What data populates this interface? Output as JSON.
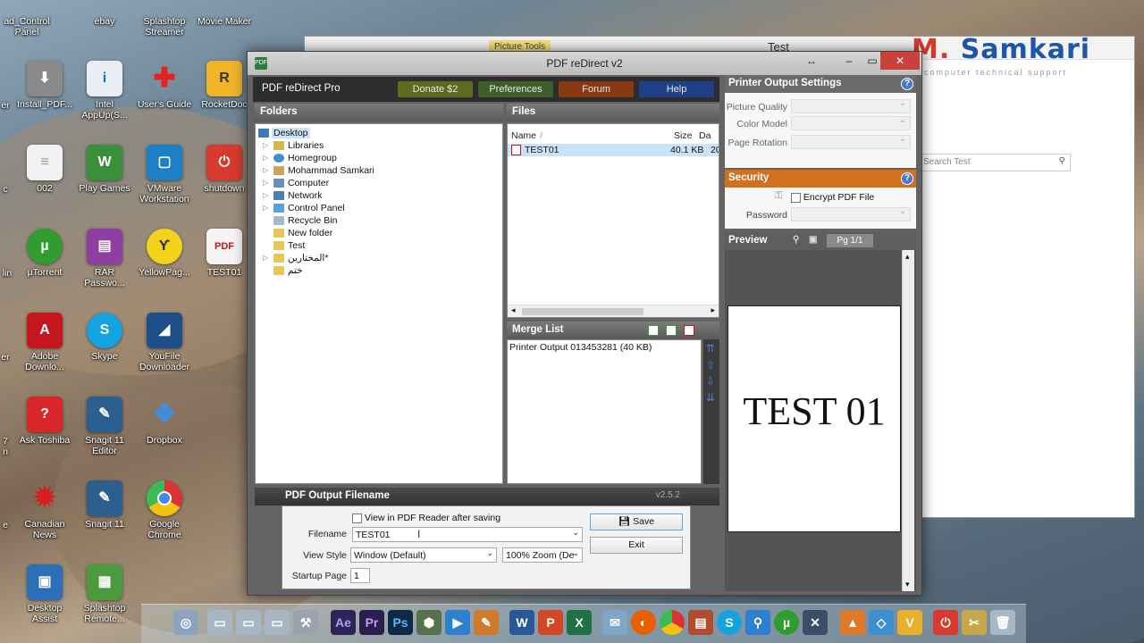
{
  "desktop": {
    "col_partial": [
      {
        "label": "ad_Control Panel"
      },
      {
        "label": "er"
      },
      {
        "label": "c"
      },
      {
        "label": "lin"
      },
      {
        "label": "er"
      },
      {
        "label": "7\nn"
      },
      {
        "label": "e"
      }
    ],
    "icons_col1": [
      {
        "label": "Install_PDF..."
      },
      {
        "label": "002"
      },
      {
        "label": "µTorrent"
      },
      {
        "label": "Adobe\nDownlo..."
      },
      {
        "label": "Ask Toshiba"
      },
      {
        "label": "Canadian\nNews"
      },
      {
        "label": "Desktop\nAssist"
      }
    ],
    "icons_col2": [
      {
        "label": "ebay"
      },
      {
        "label": "Intel\nAppUp(S..."
      },
      {
        "label": "Play Games"
      },
      {
        "label": "RAR\nPasswo..."
      },
      {
        "label": "Skype"
      },
      {
        "label": "Snagit 11\nEditor"
      },
      {
        "label": "Snagit 11"
      },
      {
        "label": "Splashtop\nRemote..."
      }
    ],
    "icons_col3": [
      {
        "label": "Splashtop\nStreamer"
      },
      {
        "label": "User's Guide"
      },
      {
        "label": "VMware\nWorkstation"
      },
      {
        "label": "YellowPag..."
      },
      {
        "label": "YouFile\nDownloader"
      },
      {
        "label": "Dropbox"
      },
      {
        "label": "Google\nChrome"
      }
    ],
    "icons_col4": [
      {
        "label": "Movie Maker"
      },
      {
        "label": "RocketDoc"
      },
      {
        "label": "shutdown"
      },
      {
        "label": "TEST01"
      }
    ]
  },
  "background_window": {
    "picture_tools": "Picture Tools",
    "title": "Test",
    "search_placeholder": "Search Test"
  },
  "logo": {
    "text_m": "M.",
    "text_name": "Samkari",
    "sub": "computer technical support"
  },
  "app": {
    "title": "PDF reDirect v2",
    "product": "PDF reDirect Pro",
    "buttons": {
      "donate": "Donate $2",
      "preferences": "Preferences",
      "forum": "Forum",
      "help": "Help"
    },
    "folders": {
      "header": "Folders",
      "items": [
        {
          "label": "Desktop"
        },
        {
          "label": "Libraries"
        },
        {
          "label": "Homegroup"
        },
        {
          "label": "Mohammad Samkari"
        },
        {
          "label": "Computer"
        },
        {
          "label": "Network"
        },
        {
          "label": "Control Panel"
        },
        {
          "label": "Recycle Bin"
        },
        {
          "label": "New folder"
        },
        {
          "label": "Test"
        },
        {
          "label": "المختارين*"
        },
        {
          "label": "ختم"
        }
      ]
    },
    "files": {
      "header": "Files",
      "col_name": "Name",
      "col_sort": "/",
      "col_size": "Size",
      "col_date": "Da",
      "rows": [
        {
          "name": "TEST01",
          "size": "40.1 KB",
          "date": "20"
        }
      ]
    },
    "merge": {
      "header": "Merge List",
      "items": [
        "Printer Output 013453281 (40 KB)"
      ]
    },
    "output": {
      "header": "PDF Output Filename",
      "version": "v2.5.2",
      "view_in_reader": "View in PDF Reader after saving",
      "filename_label": "Filename",
      "filename_value": "TEST01",
      "viewstyle_label": "View Style",
      "viewstyle_value": "Window (Default)",
      "zoom_value": "100% Zoom (De",
      "startpage_label": "Startup Page",
      "startpage_value": "1",
      "save": "Save",
      "exit": "Exit"
    },
    "settings": {
      "header": "Printer Output Settings",
      "picture_quality": "Picture Quality",
      "color_model": "Color Model",
      "page_rotation": "Page Rotation"
    },
    "security": {
      "header": "Security",
      "encrypt": "Encrypt PDF File",
      "password": "Password"
    },
    "preview": {
      "header": "Preview",
      "page": "Pg 1/1",
      "content": "TEST 01"
    },
    "colors": {
      "donate": "#5c6b1e",
      "preferences": "#3e5f2a",
      "forum": "#8a3a12",
      "help": "#1f3f86",
      "security_header": "#d2701f",
      "settings_header": "#6a6a6a"
    }
  },
  "taskbar": {
    "apps": [
      "Ae",
      "Pr",
      "Ps",
      "W",
      "P",
      "X",
      "µ"
    ]
  }
}
